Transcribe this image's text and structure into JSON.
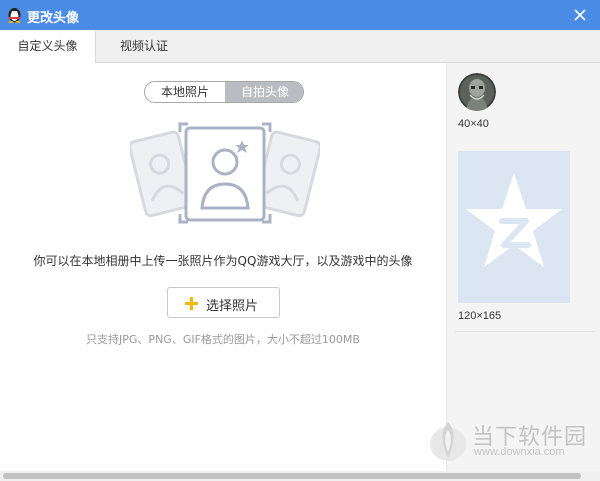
{
  "window": {
    "title": "更改头像",
    "app_icon": "qq-penguin-icon",
    "close_icon": "close-icon",
    "titlebar_color": "#4a8be6"
  },
  "tabs": [
    {
      "label": "自定义头像",
      "active": true
    },
    {
      "label": "视频认证",
      "active": false
    }
  ],
  "segment": {
    "left_label": "本地照片",
    "right_label": "自拍头像",
    "selected_color": "#b9bcc1"
  },
  "illustration_icon": "photos-portrait-icon",
  "description": "你可以在本地相册中上传一张照片作为QQ游戏大厅，以及游戏中的头像",
  "choose_button": {
    "label": "选择照片",
    "icon": "plus-icon",
    "icon_color": "#f1b70b"
  },
  "note": "只支持JPG、PNG、GIF格式的图片，大小不超过100MB",
  "preview": {
    "small_size": "40×40",
    "large_size": "120×165",
    "small_icon": "user-avatar-icon",
    "large_icon": "qq-star-logo-icon"
  },
  "watermark": {
    "title": "当下软件园",
    "url": "www.downxia.com",
    "icon": "downxia-logo-icon"
  }
}
